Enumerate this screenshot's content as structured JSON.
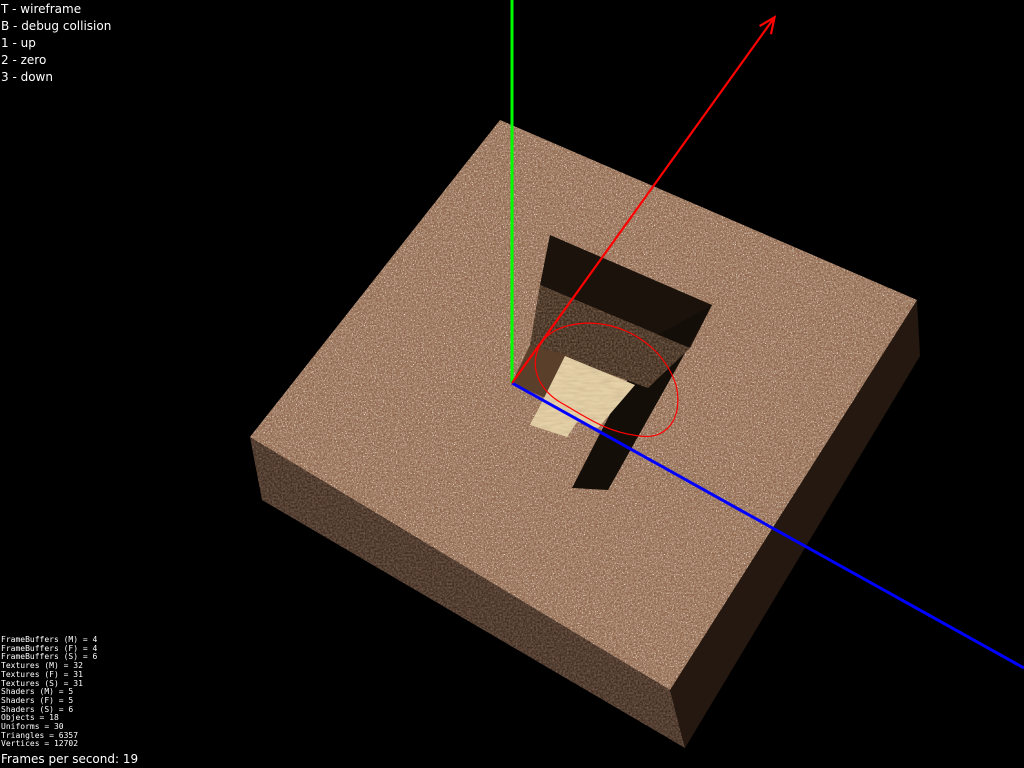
{
  "help": [
    "T - wireframe",
    "B - debug collision",
    "1 - up",
    "2 - zero",
    "3 - down"
  ],
  "stats": [
    "FrameBuffers (M) = 4",
    "FrameBuffers (F) = 4",
    "FrameBuffers (S) = 6",
    "Textures (M) = 32",
    "Textures (F) = 31",
    "Textures (S) = 31",
    "Shaders (M) = 5",
    "Shaders (F) = 5",
    "Shaders (S) = 6",
    "Objects = 18",
    "Uniforms = 30",
    "Triangles = 6357",
    "Vertices = 12702"
  ],
  "fps_text": "Frames per second: 19",
  "colors": {
    "background": "#000000",
    "axis_x": "#0000ff",
    "axis_y": "#00ff00",
    "axis_z": "#ff0000",
    "collision_debug": "#ff0000",
    "ground": "#8a6248",
    "pit_floor": "#e6d2a8"
  }
}
